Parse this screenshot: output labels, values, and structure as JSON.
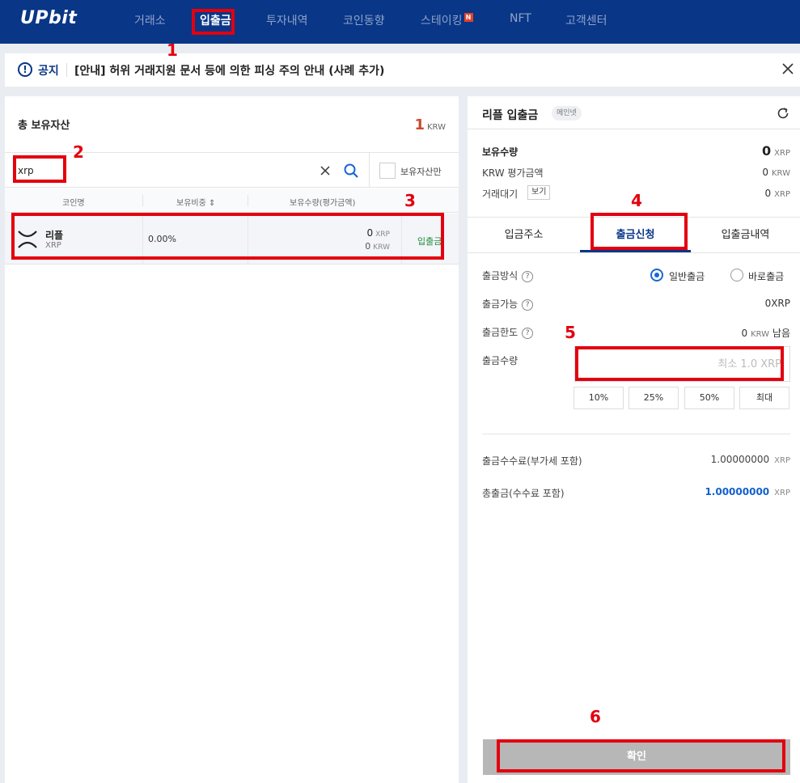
{
  "nav": {
    "logo": "UPbit",
    "items": [
      {
        "label": "거래소"
      },
      {
        "label": "입출금"
      },
      {
        "label": "투자내역"
      },
      {
        "label": "코인동향"
      },
      {
        "label": "스테이킹",
        "badge": "N"
      },
      {
        "label": "NFT"
      },
      {
        "label": "고객센터"
      }
    ],
    "active": "입출금"
  },
  "notice": {
    "label": "공지",
    "text": "[안내] 허위 거래지원 문서 등에 의한 피싱 주의 안내 (사례 추가)"
  },
  "assets": {
    "title": "총 보유자산",
    "total_value": "1",
    "total_unit": "KRW",
    "search_value": "xrp",
    "own_only_label": "보유자산만",
    "columns": [
      "코인명",
      "보유비중 ⇕",
      "보유수량(평가금액)"
    ],
    "rows": [
      {
        "name": "리플",
        "symbol": "XRP",
        "ratio": "0.00%",
        "amount": "0",
        "amount_unit": "XRP",
        "krw": "0",
        "krw_unit": "KRW",
        "action": "입출금"
      }
    ]
  },
  "transfer": {
    "title": "리플 입출금",
    "network_badge": "메인넷",
    "holding_label": "보유수량",
    "holding_value": "0",
    "holding_unit": "XRP",
    "krw_eval_label": "KRW 평가금액",
    "krw_eval_value": "0",
    "krw_eval_unit": "KRW",
    "pending_label": "거래대기",
    "view_label": "보기",
    "pending_value": "0",
    "pending_unit": "XRP",
    "tabs": [
      "입금주소",
      "출금신청",
      "입출금내역"
    ],
    "active_tab": "출금신청",
    "method_label": "출금방식",
    "method_options": [
      "일반출금",
      "바로출금"
    ],
    "method_selected": "일반출금",
    "available_label": "출금가능",
    "available_value": "0XRP",
    "limit_label": "출금한도",
    "limit_value": "0",
    "limit_unit": "KRW",
    "limit_suffix": "남음",
    "amount_label": "출금수량",
    "amount_placeholder": "최소 1.0 XRP",
    "quick_buttons": [
      "10%",
      "25%",
      "50%",
      "최대"
    ],
    "fee_label": "출금수수료(부가세 포함)",
    "fee_value": "1.00000000",
    "fee_unit": "XRP",
    "total_label": "총출금(수수료 포함)",
    "total_value": "1.00000000",
    "total_unit": "XRP",
    "confirm_label": "확인"
  },
  "annotations": [
    "1",
    "2",
    "3",
    "4",
    "5",
    "6"
  ],
  "colors": {
    "nav_bg": "#093687",
    "accent": "#093687",
    "annotation_red": "#e3000f",
    "positive_green": "#1f8a3c",
    "total_blue": "#1260cc"
  }
}
